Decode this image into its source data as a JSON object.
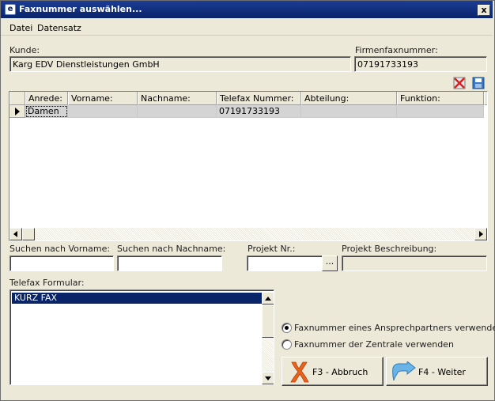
{
  "window": {
    "title": "Faxnummer auswählen...",
    "close_glyph": "x"
  },
  "menu": {
    "items": [
      "Datei",
      "Datensatz"
    ]
  },
  "kunde": {
    "label": "Kunde:",
    "value": "Karg EDV Dienstleistungen GmbH"
  },
  "firmenfax": {
    "label": "Firmenfaxnummer:",
    "value": "07191733193"
  },
  "toolbar": {
    "delete_icon": "delete-icon",
    "save_icon": "save-icon"
  },
  "grid": {
    "columns": [
      "Anrede:",
      "Vorname:",
      "Nachname:",
      "Telefax Nummer:",
      "Abteilung:",
      "Funktion:"
    ],
    "rows": [
      {
        "anrede": "Damen",
        "vorname": "",
        "nachname": "",
        "fax": "07191733193",
        "abteilung": "",
        "funktion": ""
      }
    ]
  },
  "search": {
    "vorname_label": "Suchen nach Vorname:",
    "vorname_value": "",
    "nachname_label": "Suchen nach Nachname:",
    "nachname_value": "",
    "projekt_nr_label": "Projekt Nr.:",
    "projekt_nr_value": "",
    "projekt_nr_button": "...",
    "projekt_beschreibung_label": "Projekt Beschreibung:",
    "projekt_beschreibung_value": ""
  },
  "formular": {
    "label": "Telefax Formular:",
    "items": [
      "KURZ FAX"
    ]
  },
  "options": {
    "ansprechpartner": "Faxnummer eines Ansprechpartners verwenden",
    "zentrale": "Faxnummer der Zentrale verwenden",
    "selected": "ansprechpartner"
  },
  "buttons": {
    "abbruch": "F3 - Abbruch",
    "weiter": "F4 - Weiter"
  }
}
